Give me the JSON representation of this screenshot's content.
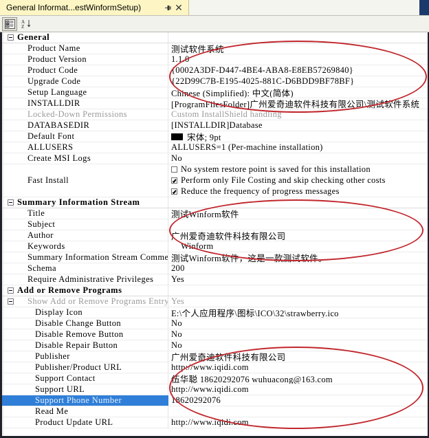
{
  "window": {
    "tab_title": "General Informat...estWinformSetup)",
    "pin_icon": "pin-icon",
    "close_icon": "close-icon"
  },
  "toolbar": {
    "categorized_label": "categorized-view",
    "alphabetical_label": "alphabetical-sort"
  },
  "colors": {
    "tab_bg": "#fdf6c4",
    "selection": "#2f7fd8",
    "annotation": "#c1272d",
    "default_font_swatch": "#000000"
  },
  "selected_row": "Support Phone Number",
  "sections": [
    {
      "name": "General",
      "expanded": true,
      "rows": [
        {
          "name": "Product Name",
          "value": "测试软件系统"
        },
        {
          "name": "Product Version",
          "value": "1.1.0"
        },
        {
          "name": "Product Code",
          "value": "{0002A3DF-D447-4BE4-ABA8-E8EB57269840}"
        },
        {
          "name": "Upgrade Code",
          "value": "{22D99C7B-E195-4025-881C-D6BDD9BF78BF}"
        },
        {
          "name": "Setup Language",
          "value": "Chinese (Simplified): 中文(简体)"
        },
        {
          "name": "INSTALLDIR",
          "value": "[ProgramFilesFolder]广州爱奇迪软件科技有限公司\\测试软件系统"
        },
        {
          "name": "Locked-Down Permissions",
          "value": "Custom InstallShield handling",
          "dim": true
        },
        {
          "name": "DATABASEDIR",
          "value": "[INSTALLDIR]Database"
        },
        {
          "name": "Default Font",
          "value": "宋体; 9pt",
          "swatch": true
        },
        {
          "name": "ALLUSERS",
          "value": "ALLUSERS=1 (Per-machine installation)"
        },
        {
          "name": "Create MSI Logs",
          "value": "No"
        },
        {
          "name": "Fast Install",
          "checkboxes": [
            {
              "label": "No system restore point is saved for this installation",
              "checked": false
            },
            {
              "label": "Perform only File Costing and skip checking other costs",
              "checked": true
            },
            {
              "label": "Reduce the frequency of progress messages",
              "checked": true
            }
          ]
        }
      ]
    },
    {
      "name": "Summary Information Stream",
      "expanded": true,
      "rows": [
        {
          "name": "Title",
          "value": "测试Winform软件"
        },
        {
          "name": "Subject",
          "value": ""
        },
        {
          "name": "Author",
          "value": "广州爱奇迪软件科技有限公司"
        },
        {
          "name": "Keywords",
          "value": "Winform",
          "indent_value": true
        },
        {
          "name": "Summary Information Stream Comments",
          "value": "测试Winform软件，这是一款测试软件。"
        },
        {
          "name": "Schema",
          "value": "200"
        },
        {
          "name": "Require Administrative Privileges",
          "value": "Yes"
        }
      ]
    },
    {
      "name": "Add or Remove Programs",
      "expanded": true,
      "rows": [
        {
          "name": "Show Add or Remove Programs Entry",
          "value": "Yes",
          "dim": true,
          "subexpander": true
        },
        {
          "name": "Display Icon",
          "value": "E:\\个人应用程序\\图标\\ICO\\32\\strawberry.ico",
          "indent2": true
        },
        {
          "name": "Disable Change Button",
          "value": "No",
          "indent2": true
        },
        {
          "name": "Disable Remove Button",
          "value": "No",
          "indent2": true
        },
        {
          "name": "Disable Repair Button",
          "value": "No",
          "indent2": true
        },
        {
          "name": "Publisher",
          "value": "广州爱奇迪软件科技有限公司",
          "indent2": true
        },
        {
          "name": "Publisher/Product URL",
          "value": "http://www.iqidi.com",
          "indent2": true
        },
        {
          "name": "Support Contact",
          "value": "伍华聪 18620292076 wuhuacong@163.com",
          "indent2": true
        },
        {
          "name": "Support URL",
          "value": "http://www.iqidi.com",
          "indent2": true
        },
        {
          "name": "Support Phone Number",
          "value": "18620292076",
          "indent2": true,
          "selected": true
        },
        {
          "name": "Read Me",
          "value": "",
          "indent2": true
        },
        {
          "name": "Product Update URL",
          "value": "http://www.iqidi.com",
          "indent2": true
        }
      ]
    }
  ]
}
